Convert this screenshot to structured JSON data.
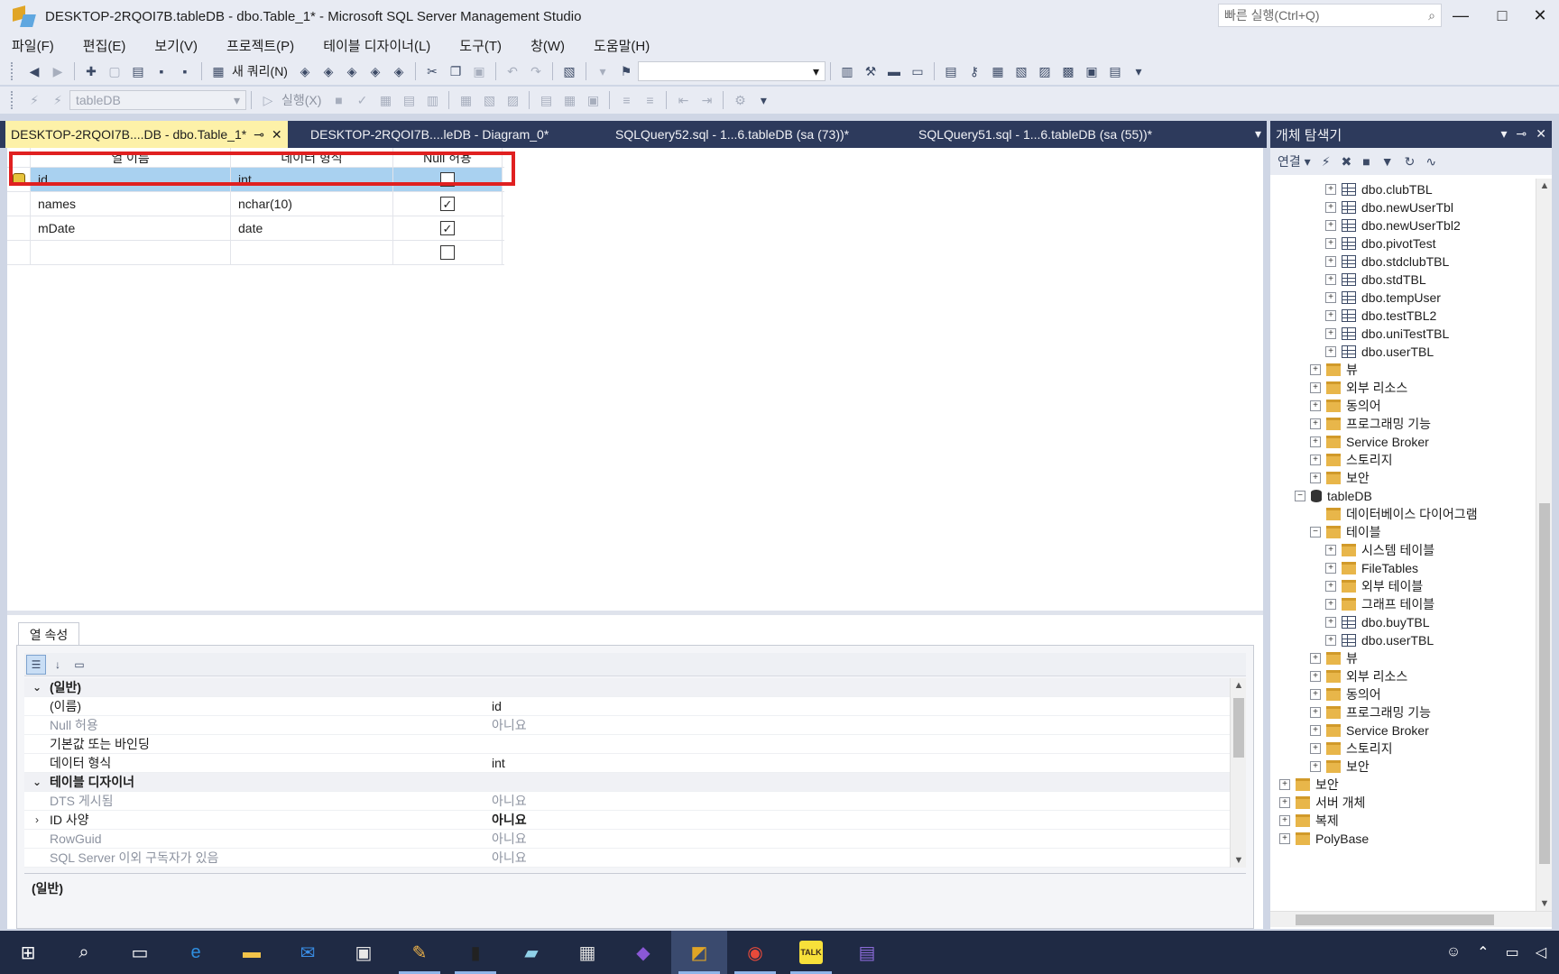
{
  "window": {
    "title": "DESKTOP-2RQOI7B.tableDB - dbo.Table_1* - Microsoft SQL Server Management Studio",
    "quick_launch_placeholder": "빠른 실행(Ctrl+Q)"
  },
  "menu": [
    "파일(F)",
    "편집(E)",
    "보기(V)",
    "프로젝트(P)",
    "테이블 디자이너(L)",
    "도구(T)",
    "창(W)",
    "도움말(H)"
  ],
  "toolbar": {
    "new_query_label": "새 쿼리(N)",
    "database_combo": "tableDB",
    "execute_label": "실행(X)"
  },
  "doc_tabs": [
    {
      "label": "DESKTOP-2RQOI7B....DB - dbo.Table_1*",
      "active": true
    },
    {
      "label": "DESKTOP-2RQOI7B....leDB - Diagram_0*",
      "active": false
    },
    {
      "label": "SQLQuery52.sql - 1...6.tableDB (sa (73))*",
      "active": false
    },
    {
      "label": "SQLQuery51.sql - 1...6.tableDB (sa (55))*",
      "active": false
    }
  ],
  "designer": {
    "headers": [
      "열 이름",
      "데이터 형식",
      "Null 허용"
    ],
    "rows": [
      {
        "name": "id",
        "type": "int",
        "nullable": false,
        "primary_key": true,
        "selected": true
      },
      {
        "name": "names",
        "type": "nchar(10)",
        "nullable": true,
        "primary_key": false,
        "selected": false
      },
      {
        "name": "mDate",
        "type": "date",
        "nullable": true,
        "primary_key": false,
        "selected": false
      },
      {
        "name": "",
        "type": "",
        "nullable": false,
        "primary_key": false,
        "selected": false
      }
    ]
  },
  "column_properties": {
    "tab_label": "열 속성",
    "rows": [
      {
        "kind": "category",
        "expander": "chevron-down",
        "name": "(일반)",
        "value": ""
      },
      {
        "kind": "item",
        "name": "(이름)",
        "value": "id"
      },
      {
        "kind": "gray",
        "name": "Null 허용",
        "value": "아니요"
      },
      {
        "kind": "item",
        "name": "기본값 또는 바인딩",
        "value": ""
      },
      {
        "kind": "item",
        "name": "데이터 형식",
        "value": "int"
      },
      {
        "kind": "category",
        "expander": "chevron-down",
        "name": "테이블 디자이너",
        "value": ""
      },
      {
        "kind": "gray",
        "name": "DTS 게시됨",
        "value": "아니요"
      },
      {
        "kind": "bold",
        "expander": "chevron-right",
        "name": "ID 사양",
        "value": "아니요"
      },
      {
        "kind": "gray",
        "name": "RowGuid",
        "value": "아니요"
      },
      {
        "kind": "gray",
        "name": "SQL Server 이외 구독자가 있음",
        "value": "아니요"
      }
    ],
    "description_title": "(일반)"
  },
  "object_explorer": {
    "title": "개체 탐색기",
    "connect_label": "연결",
    "nodes": [
      {
        "indent": 3,
        "exp": "+",
        "icon": "table",
        "label": "dbo.clubTBL"
      },
      {
        "indent": 3,
        "exp": "+",
        "icon": "table",
        "label": "dbo.newUserTbl"
      },
      {
        "indent": 3,
        "exp": "+",
        "icon": "table",
        "label": "dbo.newUserTbl2"
      },
      {
        "indent": 3,
        "exp": "+",
        "icon": "table",
        "label": "dbo.pivotTest"
      },
      {
        "indent": 3,
        "exp": "+",
        "icon": "table",
        "label": "dbo.stdclubTBL"
      },
      {
        "indent": 3,
        "exp": "+",
        "icon": "table",
        "label": "dbo.stdTBL"
      },
      {
        "indent": 3,
        "exp": "+",
        "icon": "table",
        "label": "dbo.tempUser"
      },
      {
        "indent": 3,
        "exp": "+",
        "icon": "table",
        "label": "dbo.testTBL2"
      },
      {
        "indent": 3,
        "exp": "+",
        "icon": "table",
        "label": "dbo.uniTestTBL"
      },
      {
        "indent": 3,
        "exp": "+",
        "icon": "table",
        "label": "dbo.userTBL"
      },
      {
        "indent": 2,
        "exp": "+",
        "icon": "folder",
        "label": "뷰"
      },
      {
        "indent": 2,
        "exp": "+",
        "icon": "folder",
        "label": "외부 리소스"
      },
      {
        "indent": 2,
        "exp": "+",
        "icon": "folder",
        "label": "동의어"
      },
      {
        "indent": 2,
        "exp": "+",
        "icon": "folder",
        "label": "프로그래밍 기능"
      },
      {
        "indent": 2,
        "exp": "+",
        "icon": "folder",
        "label": "Service Broker"
      },
      {
        "indent": 2,
        "exp": "+",
        "icon": "folder",
        "label": "스토리지"
      },
      {
        "indent": 2,
        "exp": "+",
        "icon": "folder",
        "label": "보안"
      },
      {
        "indent": 1,
        "exp": "-",
        "icon": "db",
        "label": "tableDB"
      },
      {
        "indent": 2,
        "exp": "",
        "icon": "folder",
        "label": "데이터베이스 다이어그램"
      },
      {
        "indent": 2,
        "exp": "-",
        "icon": "folder",
        "label": "테이블"
      },
      {
        "indent": 3,
        "exp": "+",
        "icon": "folder",
        "label": "시스템 테이블"
      },
      {
        "indent": 3,
        "exp": "+",
        "icon": "folder",
        "label": "FileTables"
      },
      {
        "indent": 3,
        "exp": "+",
        "icon": "folder",
        "label": "외부 테이블"
      },
      {
        "indent": 3,
        "exp": "+",
        "icon": "folder",
        "label": "그래프 테이블"
      },
      {
        "indent": 3,
        "exp": "+",
        "icon": "table",
        "label": "dbo.buyTBL"
      },
      {
        "indent": 3,
        "exp": "+",
        "icon": "table",
        "label": "dbo.userTBL"
      },
      {
        "indent": 2,
        "exp": "+",
        "icon": "folder",
        "label": "뷰"
      },
      {
        "indent": 2,
        "exp": "+",
        "icon": "folder",
        "label": "외부 리소스"
      },
      {
        "indent": 2,
        "exp": "+",
        "icon": "folder",
        "label": "동의어"
      },
      {
        "indent": 2,
        "exp": "+",
        "icon": "folder",
        "label": "프로그래밍 기능"
      },
      {
        "indent": 2,
        "exp": "+",
        "icon": "folder",
        "label": "Service Broker"
      },
      {
        "indent": 2,
        "exp": "+",
        "icon": "folder",
        "label": "스토리지"
      },
      {
        "indent": 2,
        "exp": "+",
        "icon": "folder",
        "label": "보안"
      },
      {
        "indent": 0,
        "exp": "+",
        "icon": "folder",
        "label": "보안"
      },
      {
        "indent": 0,
        "exp": "+",
        "icon": "folder",
        "label": "서버 개체"
      },
      {
        "indent": 0,
        "exp": "+",
        "icon": "folder",
        "label": "복제"
      },
      {
        "indent": 0,
        "exp": "+",
        "icon": "folder",
        "label": "PolyBase"
      }
    ]
  },
  "taskbar": {
    "apps": [
      {
        "name": "start-button",
        "glyph": "⊞",
        "color": "#ffffff",
        "state": ""
      },
      {
        "name": "search-icon",
        "glyph": "⌕",
        "color": "#ffffff",
        "state": ""
      },
      {
        "name": "task-view-icon",
        "glyph": "▭",
        "color": "#ffffff",
        "state": ""
      },
      {
        "name": "edge-icon",
        "glyph": "e",
        "color": "#2f8fe0",
        "state": ""
      },
      {
        "name": "file-explorer-icon",
        "glyph": "▬",
        "color": "#f2c34a",
        "state": ""
      },
      {
        "name": "mail-icon",
        "glyph": "✉",
        "color": "#3a8ee6",
        "state": ""
      },
      {
        "name": "store-icon",
        "glyph": "▣",
        "color": "#e8e8e8",
        "state": ""
      },
      {
        "name": "paint-icon",
        "glyph": "✎",
        "color": "#f0b44a",
        "state": "running"
      },
      {
        "name": "terminal-icon",
        "glyph": "▮",
        "color": "#222222",
        "state": "running"
      },
      {
        "name": "notepad-icon",
        "glyph": "▰",
        "color": "#8fd0e8",
        "state": ""
      },
      {
        "name": "calculator-icon",
        "glyph": "▦",
        "color": "#dddddd",
        "state": ""
      },
      {
        "name": "visual-studio-icon",
        "glyph": "◆",
        "color": "#8a58d6",
        "state": ""
      },
      {
        "name": "ssms-icon",
        "glyph": "◩",
        "color": "#e0a526",
        "state": "active"
      },
      {
        "name": "chrome-icon",
        "glyph": "◉",
        "color": "#e84a3a",
        "state": "running"
      },
      {
        "name": "kakaotalk-icon",
        "glyph": "TALK",
        "color": "#f7e03a",
        "state": "running"
      },
      {
        "name": "app-icon",
        "glyph": "▤",
        "color": "#8a6ad6",
        "state": ""
      }
    ]
  }
}
